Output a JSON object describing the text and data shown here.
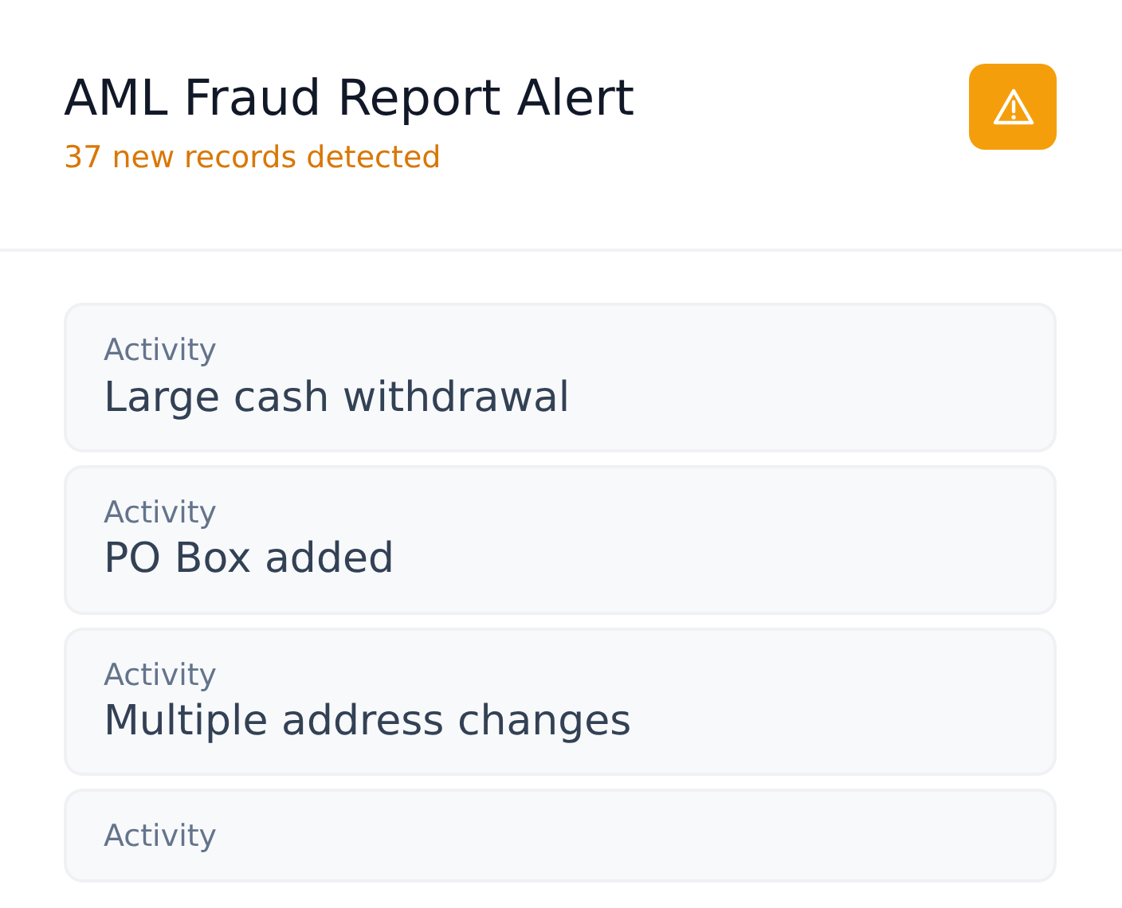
{
  "header": {
    "title": "AML Fraud Report Alert",
    "subtitle": "37 new records detected"
  },
  "records": [
    {
      "label": "Activity",
      "value": "Large cash withdrawal"
    },
    {
      "label": "Activity",
      "value": "PO Box added"
    },
    {
      "label": "Activity",
      "value": "Multiple address changes"
    },
    {
      "label": "Activity"
    }
  ]
}
